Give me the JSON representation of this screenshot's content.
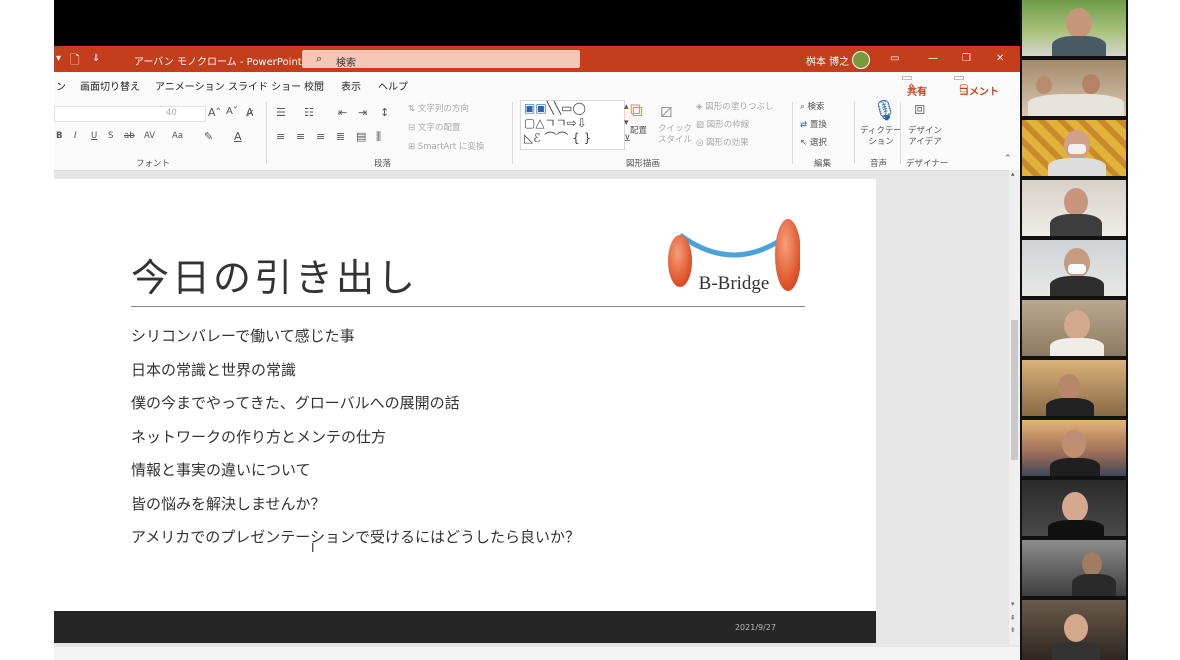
{
  "window": {
    "title": "アーバン モノクローム - PowerPoint",
    "search_placeholder": "検索",
    "user_name": "桝本 博之",
    "minimize": "—",
    "restore": "❐",
    "close": "✕"
  },
  "ribbon_tabs": [
    "ン",
    "画面切り替え",
    "アニメーション",
    "スライド ショー",
    "校閲",
    "表示",
    "ヘルプ"
  ],
  "share_label": "共有",
  "comment_label": "コメント",
  "ribbon": {
    "font_size": "40",
    "font_group": "フォント",
    "paragraph_group": "段落",
    "text_direction": "文字列の方向",
    "text_align": "文字の配置",
    "smartart": "SmartArt に変換",
    "drawing_group": "図形描画",
    "arrange": "配置",
    "quick_styles": "クイック\nスタイル",
    "shape_fill": "図形の塗りつぶし",
    "shape_outline": "図形の枠線",
    "shape_effects": "図形の効果",
    "find": "検索",
    "replace": "置換",
    "select": "選択",
    "editing_group": "編集",
    "dictate": "ディクテー\nション",
    "voice_group": "音声",
    "design_ideas": "デザイン\nアイデア",
    "designer_group": "デザイナー"
  },
  "slide": {
    "title": "今日の引き出し",
    "logo_text": "B-Bridge",
    "bullets": [
      "シリコンバレーで働いて感じた事",
      "日本の常識と世界の常識",
      "僕の今までやってきた、グローバルへの展開の話",
      "ネットワークの作り方とメンテの仕方",
      "情報と事実の違いについて",
      "皆の悩みを解決しませんか？",
      "アメリカでのプレゼンテーションで受けるにはどうしたら良いか？"
    ],
    "date": "2021/9/27"
  },
  "colors": {
    "accent": "#c43e1c",
    "logo_blue": "#4aa3d8",
    "logo_red": "#e0531f"
  }
}
